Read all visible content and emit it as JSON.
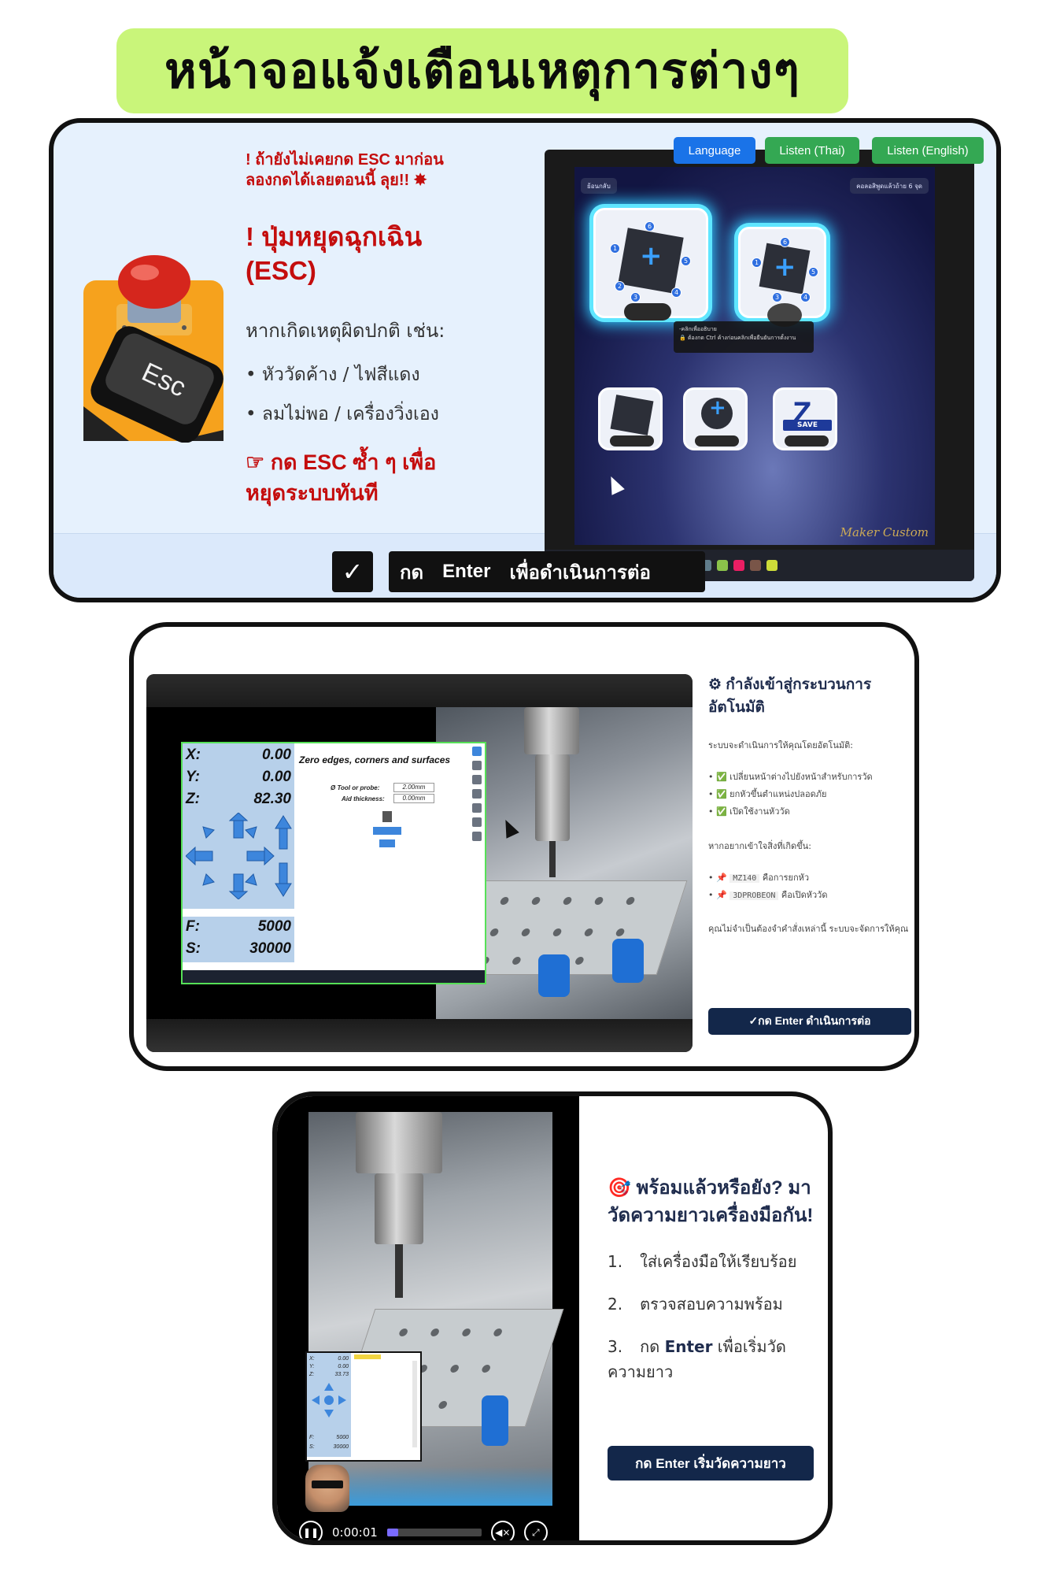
{
  "header": {
    "title": "หน้าจอแจ้งเตือนเหตุการต่างๆ"
  },
  "panel1": {
    "warning_line1": "! ถ้ายังไม่เคยกด ESC มาก่อน",
    "warning_line2": "ลองกดได้เลยตอนนี้ ลุย!! ✸",
    "esc_title_line1": "! ปุ่มหยุดฉุกเฉิน",
    "esc_title_line2": "(ESC)",
    "description": "หากเกิดเหตุผิดปกติ เช่น:",
    "list": [
      "• หัววัดค้าง / ไฟสีแดง",
      "• ลมไม่พอ / เครื่องวิ่งเอง"
    ],
    "press_line1": "☞ กด ESC ซ้ำ ๆ เพื่อ",
    "press_line2": "หยุดระบบทันที",
    "esc_key_label": "Esc",
    "screen": {
      "back_label": "ย้อนกลับ",
      "top_right_label": "คอลอสิพูดแล้วถ้าย 6 จุด",
      "buttons": {
        "language": "Language",
        "listen_thai": "Listen (Thai)",
        "listen_english": "Listen (English)"
      },
      "tooltip_line1": "-คลิกเพื่ออธิบาย",
      "tooltip_line2": "🔒 ต้องกด Ctrl ค้างก่อนคลิกเพื่อยืนยันการตั้งงาน",
      "save_label": "SAVE",
      "save_key": "Z",
      "logo_text": "Maker Custom",
      "colors": {
        "language": "#1a73e8",
        "listen": "#34a853"
      }
    },
    "enter_bar": {
      "check": "✓",
      "press": "กด",
      "key": "Enter",
      "action": "เพื่อดำเนินการต่อ"
    }
  },
  "panel2": {
    "title": "⚙ กำลังเข้าสู่กระบวนการอัตโนมัติ",
    "intro": "ระบบจะดำเนินการให้คุณโดยอัตโนมัติ:",
    "auto_list": [
      "• ✅ เปลี่ยนหน้าต่างไปยังหน้าสำหรับการวัด",
      "• ✅ ยกหัวขึ้นตำแหน่งปลอดภัย",
      "• ✅ เปิดใช้งานหัววัด"
    ],
    "manual_intro": "หากอยากเข้าใจสิ่งที่เกิดขึ้น:",
    "commands": [
      {
        "code": "MZ140",
        "desc": "คือการยกหัว"
      },
      {
        "code": "3DPROBEON",
        "desc": "คือเปิดหัววัด"
      }
    ],
    "note": "คุณไม่จำเป็นต้องจำคำสั่งเหล่านี้ ระบบจะจัดการให้คุณ",
    "button": "✓กด Enter ดำเนินการต่อ",
    "mach3": {
      "x_label": "X:",
      "x": "0.00",
      "y_label": "Y:",
      "y": "0.00",
      "z_label": "Z:",
      "z": "82.30",
      "f_label": "F:",
      "f": "5000",
      "s_label": "S:",
      "s": "30000",
      "panel_title": "Zero edges, corners and surfaces",
      "tool_label": "Ø Tool or probe:",
      "tool_value": "2.00mm",
      "aid_label": "Aid thickness:",
      "aid_value": "0.00mm"
    }
  },
  "panel3": {
    "title": "🎯 พร้อมแล้วหรือยัง? มาวัดความยาวเครื่องมือกัน!",
    "steps": [
      {
        "num": "1.",
        "text": "ใส่เครื่องมือให้เรียบร้อย"
      },
      {
        "num": "2.",
        "text": "ตรวจสอบความพร้อม"
      },
      {
        "num": "3.",
        "text_before": "กด ",
        "key": "Enter",
        "text_after": " เพื่อเริ่มวัดความยาว"
      }
    ],
    "button": "กด Enter เริ่มวัดความยาว",
    "video": {
      "time": "0:00:01",
      "progress": 0.12
    },
    "mini": {
      "x": "0.00",
      "y": "0.00",
      "z": "33.73",
      "f": "5000",
      "s": "30000"
    }
  }
}
